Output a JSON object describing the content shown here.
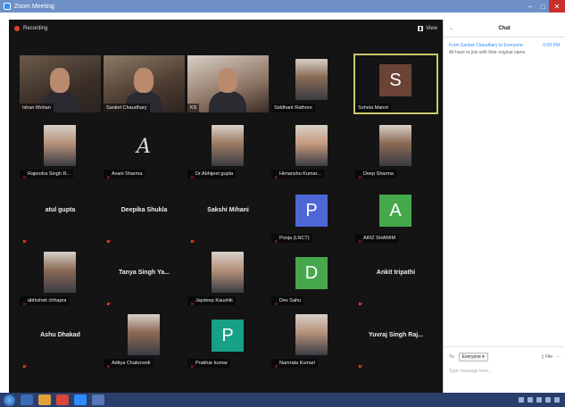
{
  "window": {
    "title": "Zoom Meeting"
  },
  "topbar": {
    "recording_label": "Recording",
    "view_label": "View"
  },
  "participants": [
    {
      "name": "Ishan Mohan",
      "kind": "video",
      "muted": false,
      "active": false
    },
    {
      "name": "Sanket Chaudhary",
      "kind": "video",
      "muted": false,
      "active": false
    },
    {
      "name": "KS",
      "kind": "video",
      "muted": false,
      "active": false
    },
    {
      "name": "Siddhant Rathore",
      "kind": "photo",
      "muted": false,
      "active": false
    },
    {
      "name": "Sohela Mannt",
      "kind": "avatar",
      "initial": "S",
      "color": "#6b4336",
      "muted": false,
      "active": true
    },
    {
      "name": "Rajendra Singh R...",
      "kind": "photo",
      "muted": true,
      "active": false
    },
    {
      "name": "Avani Sharma",
      "kind": "signature",
      "initial": "A",
      "muted": true,
      "active": false
    },
    {
      "name": "Dr.Abhijeet gupta",
      "kind": "photo",
      "muted": true,
      "active": false
    },
    {
      "name": "Himanshu Kumar...",
      "kind": "photo",
      "muted": true,
      "active": false
    },
    {
      "name": "Deep Sharma",
      "kind": "photo",
      "muted": true,
      "active": false
    },
    {
      "name": "atul gupta",
      "kind": "text",
      "muted": true,
      "active": false
    },
    {
      "name": "Deepika Shukla",
      "kind": "text",
      "muted": true,
      "active": false
    },
    {
      "name": "Sakshi Mihani",
      "kind": "text",
      "muted": true,
      "active": false
    },
    {
      "name": "Pooja (LNCT)",
      "kind": "avatar",
      "initial": "P",
      "color": "#4d67d6",
      "muted": true,
      "active": false
    },
    {
      "name": "ARIZ SHAMIM",
      "kind": "avatar",
      "initial": "A",
      "color": "#45a94b",
      "muted": true,
      "active": false
    },
    {
      "name": "abhishek chhapra",
      "kind": "photo",
      "muted": true,
      "active": false
    },
    {
      "name": "Tanya Singh Ya...",
      "kind": "text",
      "muted": true,
      "active": false
    },
    {
      "name": "Jaydeep Kaushik",
      "kind": "photo",
      "muted": true,
      "active": false
    },
    {
      "name": "Dev Sahu",
      "kind": "avatar",
      "initial": "D",
      "color": "#45a94b",
      "muted": true,
      "active": false
    },
    {
      "name": "Ankit tripathi",
      "kind": "text",
      "muted": true,
      "active": false
    },
    {
      "name": "Ashu Dhakad",
      "kind": "text",
      "muted": true,
      "active": false
    },
    {
      "name": "Aditya Chaturvedi",
      "kind": "photo",
      "muted": true,
      "active": false
    },
    {
      "name": "Prakhar kumar",
      "kind": "avatar",
      "initial": "P",
      "color": "#16a085",
      "muted": true,
      "active": false
    },
    {
      "name": "Namrata Kumari",
      "kind": "photo",
      "muted": true,
      "active": false
    },
    {
      "name": "Yuvraj Singh Raj...",
      "kind": "text",
      "muted": true,
      "active": false
    }
  ],
  "chat": {
    "title": "Chat",
    "messages": [
      {
        "from": "From Sanket Chaudhary to Everyone:",
        "time": "0:09 PM",
        "text": "All have to join with their original name"
      }
    ],
    "to_label": "To:",
    "to_value": "Everyone ▾",
    "file_label": "File",
    "more_label": "···",
    "input_placeholder": "Type message here..."
  },
  "colors": {
    "accent": "#2d8cff",
    "active_border": "#c9c96b",
    "mute": "#e0412d"
  }
}
